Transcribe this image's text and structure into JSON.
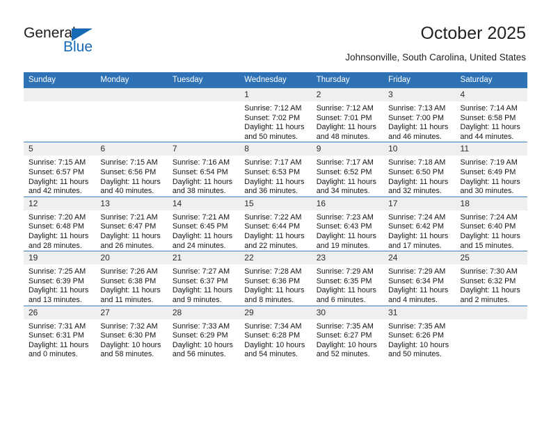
{
  "brand": {
    "name_top": "General",
    "name_bottom": "Blue",
    "accent_color": "#1669b5"
  },
  "header": {
    "title": "October 2025",
    "subtitle": "Johnsonville, South Carolina, United States",
    "header_bg_color": "#2e71b5",
    "daynum_bg_color": "#efefef"
  },
  "calendar": {
    "weekday_headers": [
      "Sunday",
      "Monday",
      "Tuesday",
      "Wednesday",
      "Thursday",
      "Friday",
      "Saturday"
    ],
    "weeks": [
      [
        {
          "day": "",
          "empty": true
        },
        {
          "day": "",
          "empty": true
        },
        {
          "day": "",
          "empty": true
        },
        {
          "day": "1",
          "sunrise": "Sunrise: 7:12 AM",
          "sunset": "Sunset: 7:02 PM",
          "daylight1": "Daylight: 11 hours",
          "daylight2": "and 50 minutes."
        },
        {
          "day": "2",
          "sunrise": "Sunrise: 7:12 AM",
          "sunset": "Sunset: 7:01 PM",
          "daylight1": "Daylight: 11 hours",
          "daylight2": "and 48 minutes."
        },
        {
          "day": "3",
          "sunrise": "Sunrise: 7:13 AM",
          "sunset": "Sunset: 7:00 PM",
          "daylight1": "Daylight: 11 hours",
          "daylight2": "and 46 minutes."
        },
        {
          "day": "4",
          "sunrise": "Sunrise: 7:14 AM",
          "sunset": "Sunset: 6:58 PM",
          "daylight1": "Daylight: 11 hours",
          "daylight2": "and 44 minutes."
        }
      ],
      [
        {
          "day": "5",
          "sunrise": "Sunrise: 7:15 AM",
          "sunset": "Sunset: 6:57 PM",
          "daylight1": "Daylight: 11 hours",
          "daylight2": "and 42 minutes."
        },
        {
          "day": "6",
          "sunrise": "Sunrise: 7:15 AM",
          "sunset": "Sunset: 6:56 PM",
          "daylight1": "Daylight: 11 hours",
          "daylight2": "and 40 minutes."
        },
        {
          "day": "7",
          "sunrise": "Sunrise: 7:16 AM",
          "sunset": "Sunset: 6:54 PM",
          "daylight1": "Daylight: 11 hours",
          "daylight2": "and 38 minutes."
        },
        {
          "day": "8",
          "sunrise": "Sunrise: 7:17 AM",
          "sunset": "Sunset: 6:53 PM",
          "daylight1": "Daylight: 11 hours",
          "daylight2": "and 36 minutes."
        },
        {
          "day": "9",
          "sunrise": "Sunrise: 7:17 AM",
          "sunset": "Sunset: 6:52 PM",
          "daylight1": "Daylight: 11 hours",
          "daylight2": "and 34 minutes."
        },
        {
          "day": "10",
          "sunrise": "Sunrise: 7:18 AM",
          "sunset": "Sunset: 6:50 PM",
          "daylight1": "Daylight: 11 hours",
          "daylight2": "and 32 minutes."
        },
        {
          "day": "11",
          "sunrise": "Sunrise: 7:19 AM",
          "sunset": "Sunset: 6:49 PM",
          "daylight1": "Daylight: 11 hours",
          "daylight2": "and 30 minutes."
        }
      ],
      [
        {
          "day": "12",
          "sunrise": "Sunrise: 7:20 AM",
          "sunset": "Sunset: 6:48 PM",
          "daylight1": "Daylight: 11 hours",
          "daylight2": "and 28 minutes."
        },
        {
          "day": "13",
          "sunrise": "Sunrise: 7:21 AM",
          "sunset": "Sunset: 6:47 PM",
          "daylight1": "Daylight: 11 hours",
          "daylight2": "and 26 minutes."
        },
        {
          "day": "14",
          "sunrise": "Sunrise: 7:21 AM",
          "sunset": "Sunset: 6:45 PM",
          "daylight1": "Daylight: 11 hours",
          "daylight2": "and 24 minutes."
        },
        {
          "day": "15",
          "sunrise": "Sunrise: 7:22 AM",
          "sunset": "Sunset: 6:44 PM",
          "daylight1": "Daylight: 11 hours",
          "daylight2": "and 22 minutes."
        },
        {
          "day": "16",
          "sunrise": "Sunrise: 7:23 AM",
          "sunset": "Sunset: 6:43 PM",
          "daylight1": "Daylight: 11 hours",
          "daylight2": "and 19 minutes."
        },
        {
          "day": "17",
          "sunrise": "Sunrise: 7:24 AM",
          "sunset": "Sunset: 6:42 PM",
          "daylight1": "Daylight: 11 hours",
          "daylight2": "and 17 minutes."
        },
        {
          "day": "18",
          "sunrise": "Sunrise: 7:24 AM",
          "sunset": "Sunset: 6:40 PM",
          "daylight1": "Daylight: 11 hours",
          "daylight2": "and 15 minutes."
        }
      ],
      [
        {
          "day": "19",
          "sunrise": "Sunrise: 7:25 AM",
          "sunset": "Sunset: 6:39 PM",
          "daylight1": "Daylight: 11 hours",
          "daylight2": "and 13 minutes."
        },
        {
          "day": "20",
          "sunrise": "Sunrise: 7:26 AM",
          "sunset": "Sunset: 6:38 PM",
          "daylight1": "Daylight: 11 hours",
          "daylight2": "and 11 minutes."
        },
        {
          "day": "21",
          "sunrise": "Sunrise: 7:27 AM",
          "sunset": "Sunset: 6:37 PM",
          "daylight1": "Daylight: 11 hours",
          "daylight2": "and 9 minutes."
        },
        {
          "day": "22",
          "sunrise": "Sunrise: 7:28 AM",
          "sunset": "Sunset: 6:36 PM",
          "daylight1": "Daylight: 11 hours",
          "daylight2": "and 8 minutes."
        },
        {
          "day": "23",
          "sunrise": "Sunrise: 7:29 AM",
          "sunset": "Sunset: 6:35 PM",
          "daylight1": "Daylight: 11 hours",
          "daylight2": "and 6 minutes."
        },
        {
          "day": "24",
          "sunrise": "Sunrise: 7:29 AM",
          "sunset": "Sunset: 6:34 PM",
          "daylight1": "Daylight: 11 hours",
          "daylight2": "and 4 minutes."
        },
        {
          "day": "25",
          "sunrise": "Sunrise: 7:30 AM",
          "sunset": "Sunset: 6:32 PM",
          "daylight1": "Daylight: 11 hours",
          "daylight2": "and 2 minutes."
        }
      ],
      [
        {
          "day": "26",
          "sunrise": "Sunrise: 7:31 AM",
          "sunset": "Sunset: 6:31 PM",
          "daylight1": "Daylight: 11 hours",
          "daylight2": "and 0 minutes."
        },
        {
          "day": "27",
          "sunrise": "Sunrise: 7:32 AM",
          "sunset": "Sunset: 6:30 PM",
          "daylight1": "Daylight: 10 hours",
          "daylight2": "and 58 minutes."
        },
        {
          "day": "28",
          "sunrise": "Sunrise: 7:33 AM",
          "sunset": "Sunset: 6:29 PM",
          "daylight1": "Daylight: 10 hours",
          "daylight2": "and 56 minutes."
        },
        {
          "day": "29",
          "sunrise": "Sunrise: 7:34 AM",
          "sunset": "Sunset: 6:28 PM",
          "daylight1": "Daylight: 10 hours",
          "daylight2": "and 54 minutes."
        },
        {
          "day": "30",
          "sunrise": "Sunrise: 7:35 AM",
          "sunset": "Sunset: 6:27 PM",
          "daylight1": "Daylight: 10 hours",
          "daylight2": "and 52 minutes."
        },
        {
          "day": "31",
          "sunrise": "Sunrise: 7:35 AM",
          "sunset": "Sunset: 6:26 PM",
          "daylight1": "Daylight: 10 hours",
          "daylight2": "and 50 minutes."
        },
        {
          "day": "",
          "empty": true
        }
      ]
    ]
  }
}
